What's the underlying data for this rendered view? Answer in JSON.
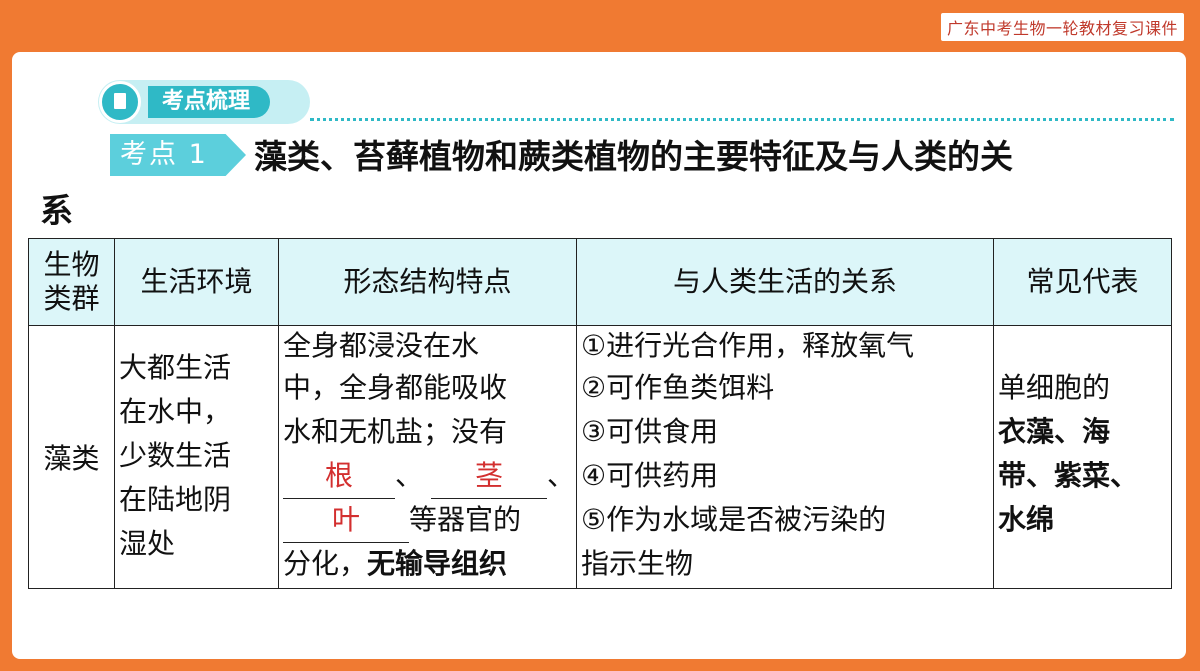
{
  "header": {
    "series_label": "广东中考生物一轮教材复习课件"
  },
  "section": {
    "label": "考点梳理"
  },
  "point": {
    "tag": "考点 1",
    "title_line1": "藻类、苔藓植物和蕨类植物的主要特征及与人类的关",
    "title_line2": "系"
  },
  "table": {
    "headers": [
      "生物类群",
      "生活环境",
      "形态结构特点",
      "与人类生活的关系",
      "常见代表"
    ],
    "header_group_line1": "生物",
    "header_group_line2": "类群",
    "row": {
      "group": "藻类",
      "environment": [
        "大都生活",
        "在水中，",
        "少数生活",
        "在陆地阴",
        "湿处"
      ],
      "structure": {
        "line1": "全身都浸没在水",
        "line2": "中，全身都能吸收",
        "line3": "水和无机盐；没有",
        "blank1": "根",
        "sep1": "、",
        "blank2": "茎",
        "sep2": "、",
        "blank3": "叶",
        "after_blank3": "等器官的",
        "line6_a": "分化，",
        "line6_b": "无输导组织"
      },
      "relations": [
        "①进行光合作用，释放氧气",
        "②可作鱼类饵料",
        "③可供食用",
        "④可供药用",
        "⑤作为水域是否被污染的",
        "指示生物"
      ],
      "examples": [
        "单细胞的",
        "衣藻、海",
        "带、紫菜、",
        "水绵"
      ]
    }
  }
}
